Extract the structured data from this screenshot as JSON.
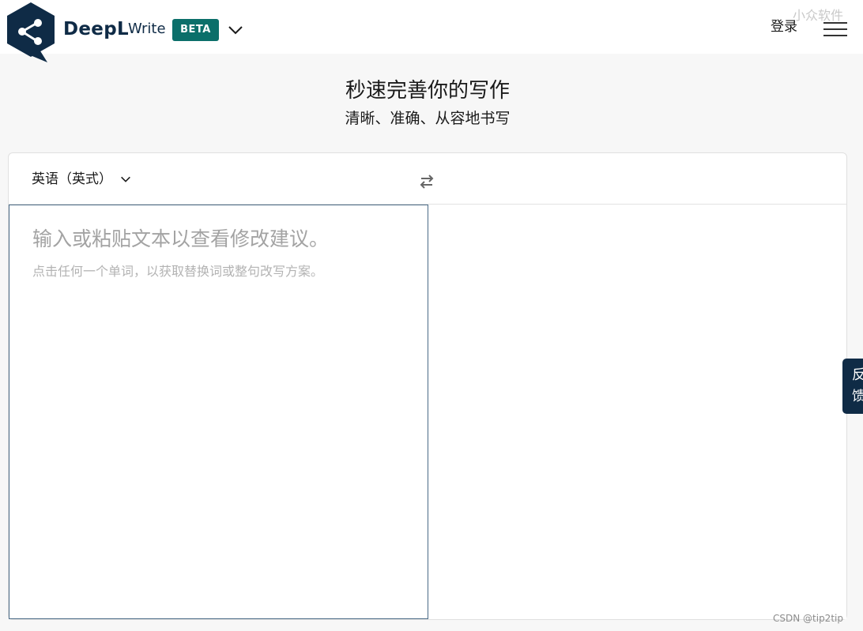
{
  "header": {
    "brand_name": "DeepL",
    "brand_product": "Write",
    "badge": "BETA",
    "login_label": "登录"
  },
  "watermark": {
    "top": "小众软件",
    "bottom": "CSDN @tip2tip"
  },
  "hero": {
    "title": "秒速完善你的写作",
    "subtitle": "清晰、准确、从容地书写"
  },
  "editor": {
    "language": "英语（英式）",
    "input_placeholder": "输入或粘贴文本以查看修改建议。",
    "input_hint": "点击任何一个单词，以获取替换词或整句改写方案。"
  },
  "feedback": {
    "label_line1": "反",
    "label_line2": "馈"
  },
  "colors": {
    "brand_navy": "#0f2b46",
    "badge_teal": "#0b6f6a",
    "page_background": "#f7f7f7"
  },
  "icons": [
    "deepl-logo-icon",
    "chevron-down-icon",
    "menu-icon",
    "swap-arrows-icon"
  ]
}
